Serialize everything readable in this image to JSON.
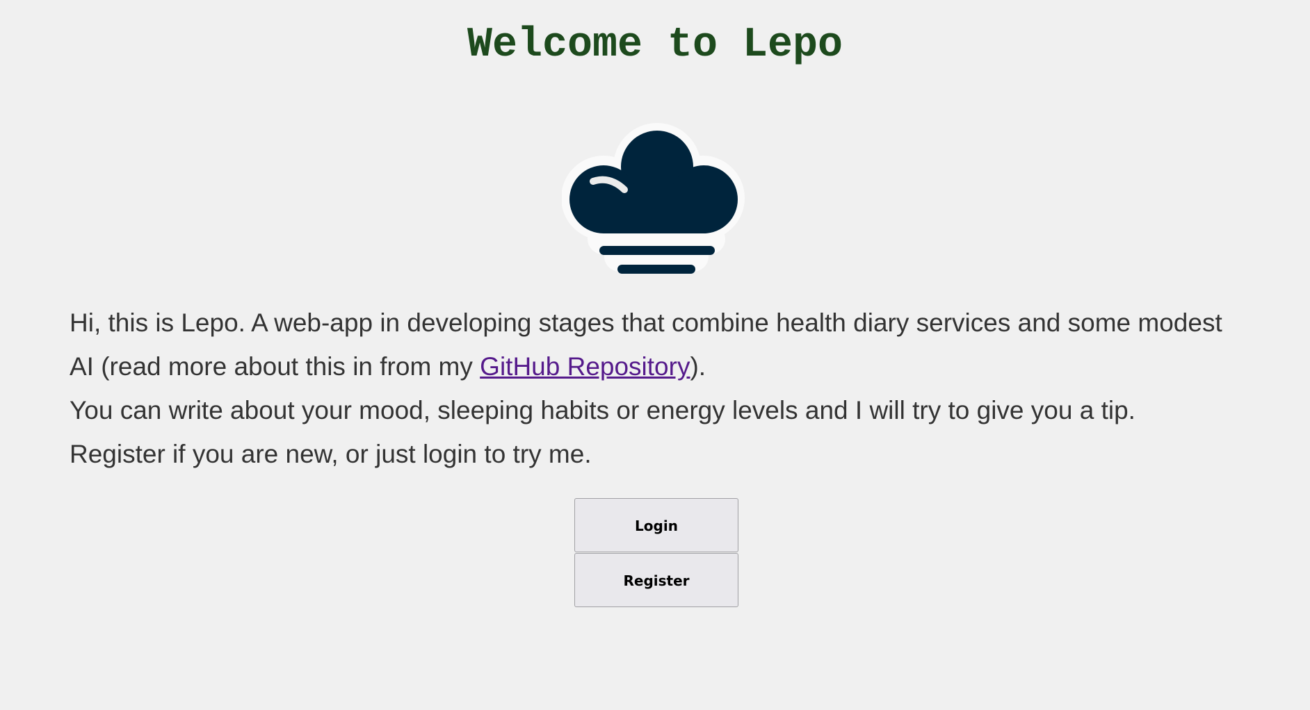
{
  "header": {
    "title": "Welcome to Lepo"
  },
  "logo": {
    "icon": "cloud-icon",
    "color": "#00243c"
  },
  "intro": {
    "line1": "Hi, this is Lepo. A web-app in developing stages that combine health diary services and some modest AI (read more about this in from my ",
    "link_text": "GitHub Repository",
    "line1_end": ").",
    "line2": "You can write about your mood, sleeping habits or energy levels and I will try to give you a tip.",
    "line3": "Register if you are new, or just login to try me."
  },
  "actions": {
    "login_label": "Login",
    "register_label": "Register"
  },
  "colors": {
    "background": "#f0f0f0",
    "title": "#1d4a1d",
    "link": "#551a8b",
    "text": "#333333"
  }
}
